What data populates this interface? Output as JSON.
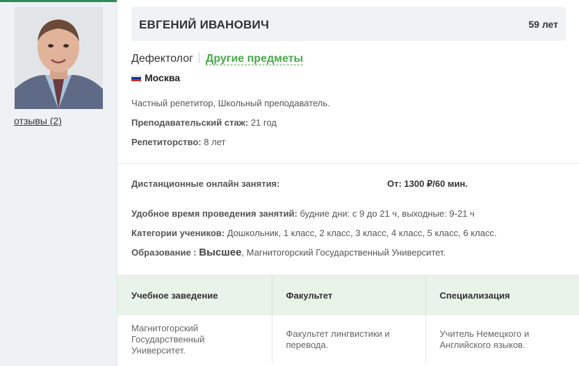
{
  "profile": {
    "reviews_link": "отзывы (2)",
    "name": "ЕВГЕНИЙ ИВАНОВИЧ",
    "age": "59 лет",
    "subject": "Дефектолог",
    "other_subjects": "Другие предметы",
    "city": "Москва",
    "flag_colors": [
      "#ffffff",
      "#0039a6",
      "#d52b1e"
    ],
    "roles": "Частный репетитор, Школьный преподаватель.",
    "teaching_exp_label": "Преподавательский стаж:",
    "teaching_exp_value": "21 год",
    "tutoring_label": "Репетиторство:",
    "tutoring_value": "8 лет"
  },
  "lessons": {
    "online_label": "Дистанционные онлайн занятия:",
    "price": "От: 1300 ₽/60 мин.",
    "time_label": "Удобное время проведения занятий:",
    "time_value": "будние дни: с 9 до 21 ч, выходные: 9-21 ч",
    "categories_label": "Категории учеников:",
    "categories_value": "Дошкольник, 1 класс, 2 класс, 3 класс, 4 класс, 5 класс, 6 класс.",
    "education_label": "Образование :",
    "education_level": "Высшее",
    "education_value": ", Магнитогорский Государственный Университет."
  },
  "education_table": {
    "headers": [
      "Учебное заведение",
      "Факультет",
      "Специализация"
    ],
    "rows": [
      [
        "Магнитогорский Государственный Университет.",
        "Факультет лингвистики и перевода.",
        "Учитель Немецкого и Английского языков."
      ]
    ]
  },
  "colors": {
    "accent_green": "#49a84b",
    "table_header_bg": "#e8f3ea"
  }
}
